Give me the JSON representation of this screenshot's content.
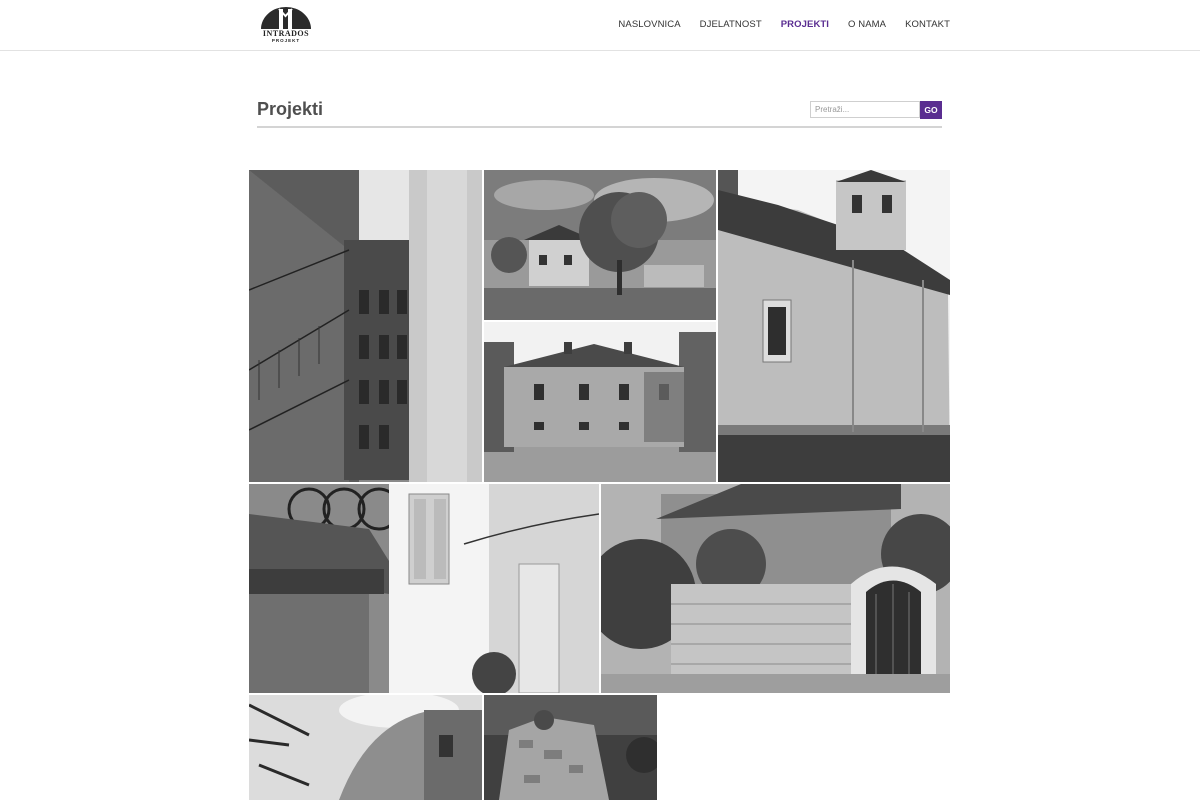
{
  "header": {
    "logo": {
      "brand": "INTRADOS",
      "sub": "PROJEKT"
    },
    "nav": [
      {
        "label": "NASLOVNICA",
        "active": false
      },
      {
        "label": "DJELATNOST",
        "active": false
      },
      {
        "label": "PROJEKTI",
        "active": true
      },
      {
        "label": "O NAMA",
        "active": false
      },
      {
        "label": "KONTAKT",
        "active": false
      }
    ]
  },
  "main": {
    "title": "Projekti",
    "search": {
      "placeholder": "Pretraži...",
      "value": "",
      "button_label": "GO"
    }
  },
  "colors": {
    "accent": "#5a2d91",
    "text": "#4f4f4f",
    "rule": "#d4d4d4"
  },
  "gallery": [
    {
      "subject": "courtyard-balconies"
    },
    {
      "subject": "tree-in-field"
    },
    {
      "subject": "church-with-bell-tower"
    },
    {
      "subject": "abandoned-two-story-house"
    },
    {
      "subject": "ornate-balcony"
    },
    {
      "subject": "stone-wall-archway"
    },
    {
      "subject": "ruined-building"
    },
    {
      "subject": "stone-tower-ruin"
    }
  ]
}
